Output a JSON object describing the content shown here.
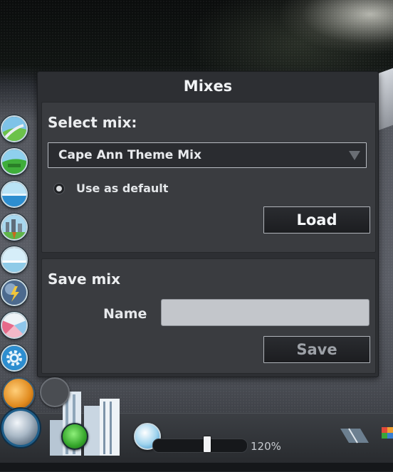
{
  "panel": {
    "title": "Mixes",
    "select_section": {
      "title": "Select mix:",
      "dropdown_value": "Cape Ann Theme Mix",
      "default_label": "Use as default",
      "default_selected": true,
      "load_label": "Load"
    },
    "save_section": {
      "title": "Save mix",
      "name_label": "Name",
      "name_value": "",
      "save_label": "Save"
    }
  },
  "sidebar": {
    "buttons": [
      {
        "name": "roads-tool",
        "icon": "road-icon"
      },
      {
        "name": "zoning-tool",
        "icon": "zoning-icon"
      },
      {
        "name": "water-tool",
        "icon": "water-icon"
      },
      {
        "name": "public-transport-tool",
        "icon": "transport-icon"
      },
      {
        "name": "landscaping-tool",
        "icon": "landscape-icon"
      },
      {
        "name": "disasters-tool",
        "icon": "disaster-icon"
      },
      {
        "name": "districts-tool",
        "icon": "districts-icon"
      },
      {
        "name": "settings-tool",
        "icon": "gear-icon"
      }
    ]
  },
  "toolbar": {
    "zoom_level": 120,
    "zoom_text": "120%"
  },
  "colors": {
    "panel_bg": "#2d2f33",
    "section_bg": "#3a3c40",
    "accent_blue": "#2c86c2"
  }
}
